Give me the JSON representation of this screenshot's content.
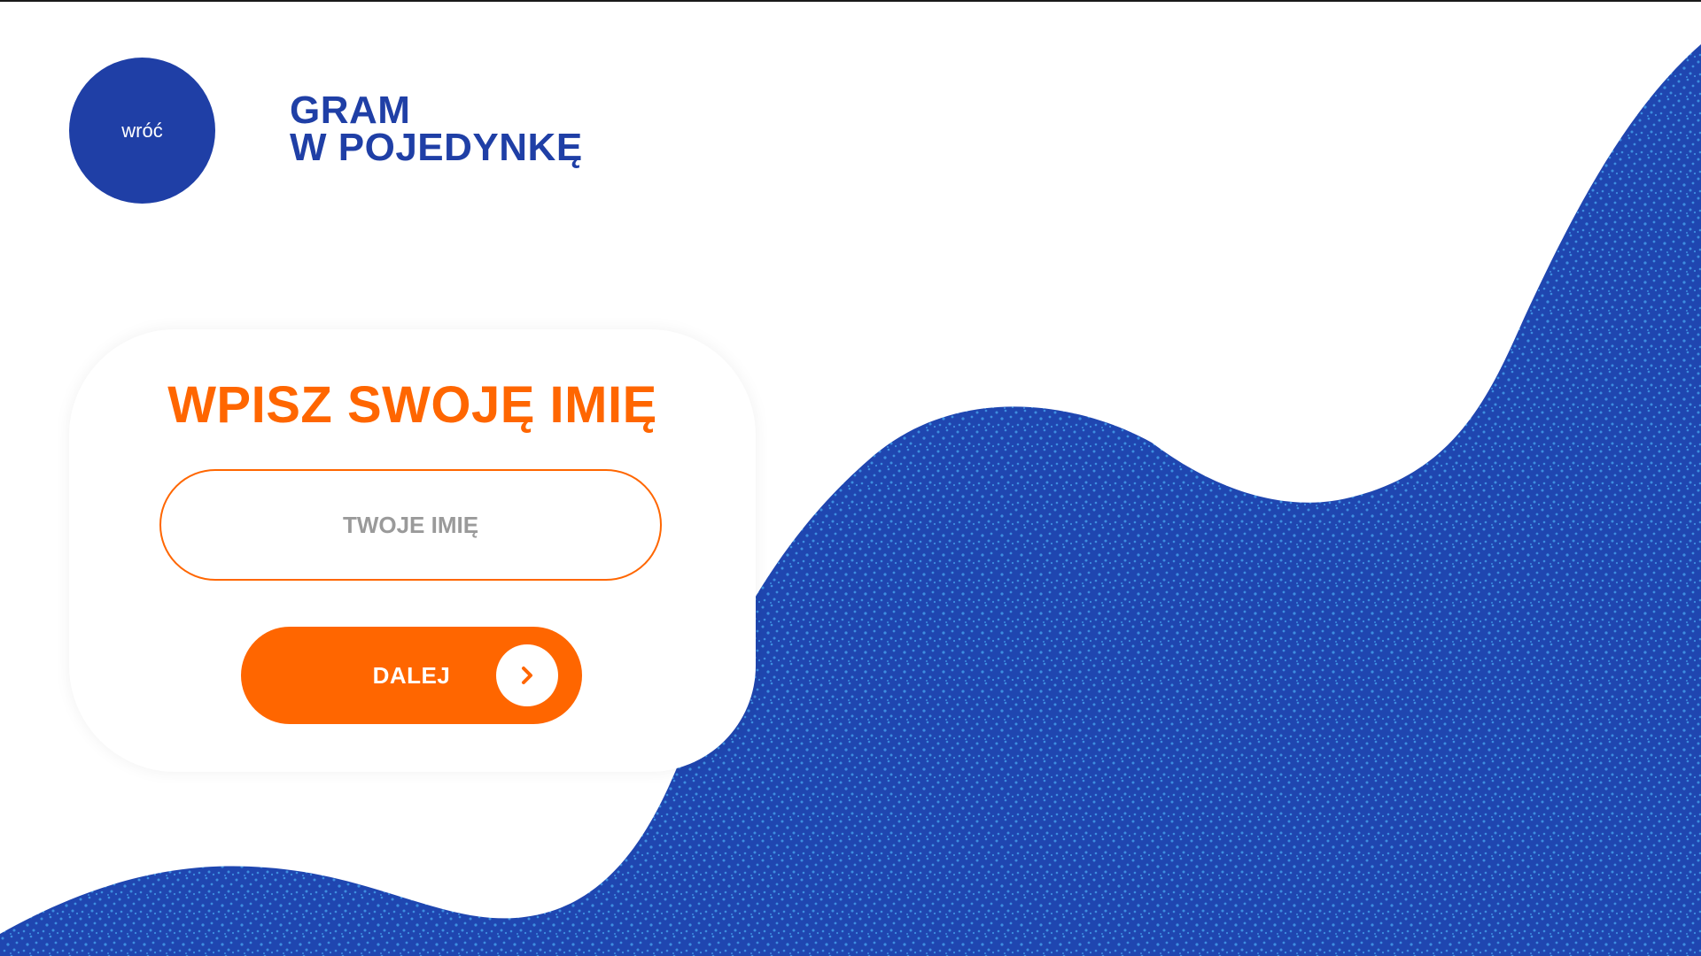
{
  "header": {
    "back_label": "wróć",
    "title_line1": "GRAM",
    "title_line2": "W POJEDYNKĘ"
  },
  "form": {
    "title": "WPISZ SWOJĘ IMIĘ",
    "name_value": "",
    "name_placeholder": "TWOJE IMIĘ",
    "submit_label": "DALEJ",
    "submit_icon": "chevron-right-icon"
  },
  "colors": {
    "brand_blue": "#1f3fa6",
    "accent_orange": "#ff6600",
    "dot_blue": "#3f8fe0",
    "background": "#ffffff"
  }
}
